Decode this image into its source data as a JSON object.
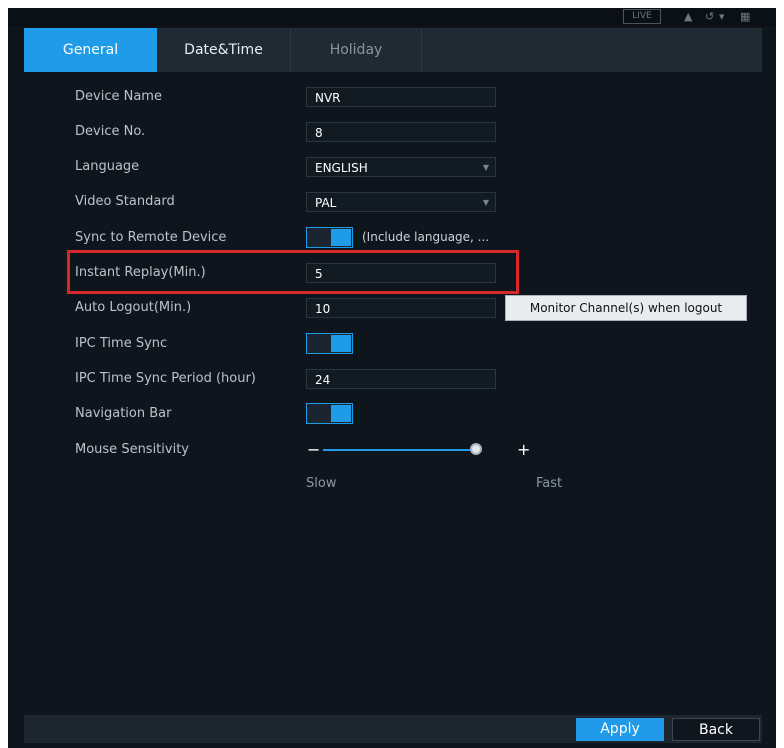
{
  "topbar": {
    "live_badge": "LIVE",
    "icons": [
      "user-icon",
      "logout-icon",
      "grid-icon"
    ]
  },
  "tabs": [
    {
      "label": "General",
      "active": true
    },
    {
      "label": "Date&Time",
      "active": false
    },
    {
      "label": "Holiday",
      "active": false
    }
  ],
  "form": {
    "device_name": {
      "label": "Device Name",
      "value": "NVR"
    },
    "device_no": {
      "label": "Device No.",
      "value": "8"
    },
    "language": {
      "label": "Language",
      "value": "ENGLISH"
    },
    "video_standard": {
      "label": "Video Standard",
      "value": "PAL"
    },
    "sync_remote": {
      "label": "Sync to Remote Device",
      "enabled": true,
      "note": "(Include language, ..."
    },
    "instant_replay": {
      "label": "Instant Replay(Min.)",
      "value": "5"
    },
    "auto_logout": {
      "label": "Auto Logout(Min.)",
      "value": "10",
      "tooltip": "Monitor Channel(s) when logout"
    },
    "ipc_time_sync": {
      "label": "IPC Time Sync",
      "enabled": true
    },
    "ipc_time_sync_period": {
      "label": "IPC Time Sync Period (hour)",
      "value": "24"
    },
    "navigation_bar": {
      "label": "Navigation Bar",
      "enabled": true
    },
    "mouse_sensitivity": {
      "label": "Mouse Sensitivity",
      "minus": "−",
      "plus": "+",
      "slow_label": "Slow",
      "fast_label": "Fast",
      "level": 1.0
    }
  },
  "buttons": {
    "apply": "Apply",
    "back": "Back"
  },
  "colors": {
    "accent": "#1f9bea",
    "highlight": "#d8272b",
    "background": "#0f151c"
  }
}
